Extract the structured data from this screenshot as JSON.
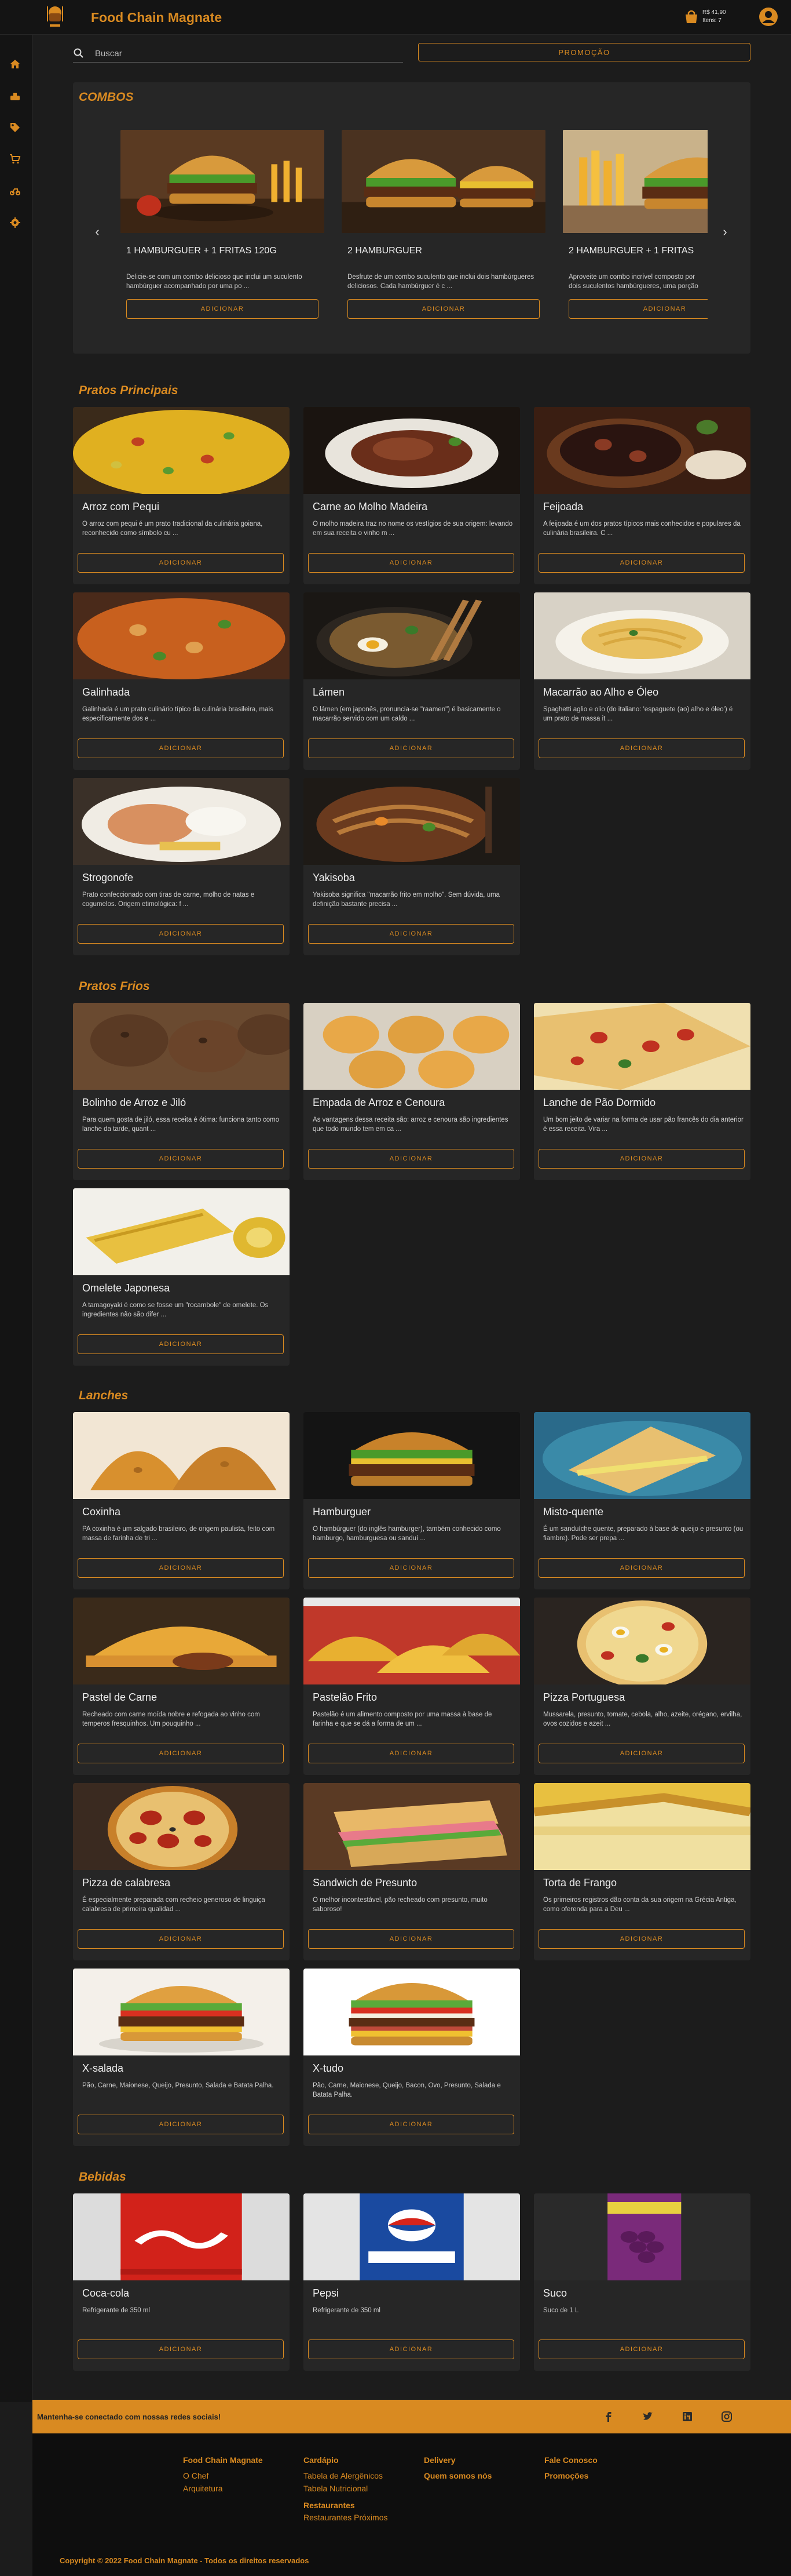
{
  "header": {
    "brand": "Food Chain Magnate",
    "cart_total": "R$ 41,90",
    "cart_items": "Itens: 7"
  },
  "search": {
    "placeholder": "Buscar",
    "value": ""
  },
  "promo_label": "PROMOÇÃO",
  "sidebar": {
    "items": [
      {
        "icon": "home-icon"
      },
      {
        "icon": "tools-icon"
      },
      {
        "icon": "tag-icon"
      },
      {
        "icon": "cart-icon"
      },
      {
        "icon": "delivery-icon"
      },
      {
        "icon": "settings-icon"
      }
    ]
  },
  "combos": {
    "title": "COMBOS",
    "items": [
      {
        "title": "1 HAMBURGUER + 1 FRITAS 120G",
        "desc": "Delicie-se com um combo delicioso que inclui um suculento hambúrguer acompanhado por uma po ...",
        "button": "ADICIONAR"
      },
      {
        "title": "2 HAMBURGUER",
        "desc": "Desfrute de um combo suculento que inclui dois hambúrgueres deliciosos. Cada hambúrguer é c ...",
        "button": "ADICIONAR"
      },
      {
        "title": "2 HAMBURGUER + 1 FRITAS",
        "desc": "Aproveite um combo incrível composto por dois suculentos hambúrgueres, uma porção",
        "button": "ADICIONAR"
      }
    ]
  },
  "sections": [
    {
      "title": "Pratos Principais",
      "items": [
        {
          "title": "Arroz com Pequi",
          "desc": "O arroz com pequi é um prato tradicional da culinária goiana, reconhecido como símbolo cu ...",
          "button": "ADICIONAR"
        },
        {
          "title": "Carne ao Molho Madeira",
          "desc": "O molho madeira traz no nome os vestígios de sua origem: levando em sua receita o vinho m ...",
          "button": "ADICIONAR"
        },
        {
          "title": "Feijoada",
          "desc": "A feijoada é um dos pratos típicos mais conhecidos e populares da culinária brasileira. C ...",
          "button": "ADICIONAR"
        },
        {
          "title": "Galinhada",
          "desc": "Galinhada é um prato culinário típico da culinária brasileira, mais especificamente dos e ...",
          "button": "ADICIONAR"
        },
        {
          "title": "Lámen",
          "desc": "O lámen (em japonês, pronuncia-se \"raamen\") é basicamente o macarrão servido com um caldo ...",
          "button": "ADICIONAR"
        },
        {
          "title": "Macarrão ao Alho e Óleo",
          "desc": "Spaghetti aglio e olio (do italiano: 'espaguete (ao) alho e óleo') é um prato de massa it ...",
          "button": "ADICIONAR"
        },
        {
          "title": "Strogonofe",
          "desc": "Prato confeccionado com tiras de carne, molho de natas e cogumelos. Origem etimológica: f ...",
          "button": "ADICIONAR"
        },
        {
          "title": "Yakisoba",
          "desc": "Yakisoba significa \"macarrão frito em molho\". Sem dúvida, uma definição bastante precisa ...",
          "button": "ADICIONAR"
        }
      ]
    },
    {
      "title": "Pratos Frios",
      "items": [
        {
          "title": "Bolinho de Arroz e Jiló",
          "desc": "Para quem gosta de jiló, essa receita é ótima: funciona tanto como lanche da tarde, quant ...",
          "button": "ADICIONAR"
        },
        {
          "title": "Empada de Arroz e Cenoura",
          "desc": "As vantagens dessa receita são: arroz e cenoura são ingredientes que todo mundo tem em ca ...",
          "button": "ADICIONAR"
        },
        {
          "title": "Lanche de Pão Dormido",
          "desc": "Um bom jeito de variar na forma de usar pão francês do dia anterior é essa receita. Vira ...",
          "button": "ADICIONAR"
        },
        {
          "title": "Omelete Japonesa",
          "desc": "A tamagoyaki é como se fosse um \"rocambole\" de omelete. Os ingredientes não são difer ...",
          "button": "ADICIONAR"
        }
      ]
    },
    {
      "title": "Lanches",
      "items": [
        {
          "title": "Coxinha",
          "desc": "PA coxinha é um salgado brasileiro, de origem paulista, feito com massa de farinha de tri ...",
          "button": "ADICIONAR"
        },
        {
          "title": "Hamburguer",
          "desc": "O hambúrguer (do inglês hamburger), também conhecido como hamburgo, hamburguesa ou sanduí ...",
          "button": "ADICIONAR"
        },
        {
          "title": "Misto-quente",
          "desc": "É um sanduíche quente, preparado à base de queijo e presunto (ou fiambre). Pode ser prepa ...",
          "button": "ADICIONAR"
        },
        {
          "title": "Pastel de Carne",
          "desc": "Recheado com carne moída nobre e refogada ao vinho com temperos fresquinhos. Um pouquinho ...",
          "button": "ADICIONAR"
        },
        {
          "title": "Pastelão Frito",
          "desc": "Pastelão é um alimento composto por uma massa à base de farinha e que se dá a forma de um ...",
          "button": "ADICIONAR"
        },
        {
          "title": "Pizza Portuguesa",
          "desc": "Mussarela, presunto, tomate, cebola, alho, azeite, orégano, ervilha, ovos cozidos e azeit ...",
          "button": "ADICIONAR"
        },
        {
          "title": "Pizza de calabresa",
          "desc": "É especialmente preparada com recheio generoso de linguiça calabresa de primeira qualidad ...",
          "button": "ADICIONAR"
        },
        {
          "title": "Sandwich de Presunto",
          "desc": "O melhor incontestável, pão recheado com presunto, muito saboroso!",
          "button": "ADICIONAR"
        },
        {
          "title": "Torta de Frango",
          "desc": "Os primeiros registros dão conta da sua origem na Grécia Antiga, como oferenda para a Deu ...",
          "button": "ADICIONAR"
        },
        {
          "title": "X-salada",
          "desc": "Pão, Carne, Maionese, Queijo, Presunto, Salada e Batata Palha.",
          "button": "ADICIONAR"
        },
        {
          "title": "X-tudo",
          "desc": "Pão, Carne, Maionese, Queijo, Bacon, Ovo, Presunto, Salada e Batata Palha.",
          "button": "ADICIONAR"
        }
      ]
    },
    {
      "title": "Bebidas",
      "items": [
        {
          "title": "Coca-cola",
          "desc": "Refrigerante de 350 ml",
          "button": "ADICIONAR"
        },
        {
          "title": "Pepsi",
          "desc": "Refrigerante de 350 ml",
          "button": "ADICIONAR"
        },
        {
          "title": "Suco",
          "desc": "Suco de 1 L",
          "button": "ADICIONAR"
        }
      ]
    }
  ],
  "social": {
    "text": "Mantenha-se conectado com nossas redes sociais!",
    "icons": [
      "facebook-icon",
      "twitter-icon",
      "linkedin-icon",
      "instagram-icon"
    ]
  },
  "footer": {
    "columns": [
      {
        "heading": "Food Chain Magnate",
        "items": [
          "O Chef",
          "Arquitetura"
        ]
      },
      {
        "heading": "Cardápio",
        "items": [
          "Tabela de Alergênicos",
          "Tabela Nutricional"
        ],
        "heading2": "Restaurantes",
        "items2": [
          "Restaurantes Próximos"
        ]
      },
      {
        "heading": "Delivery",
        "items": [
          "Quem somos nós"
        ]
      },
      {
        "heading": "Fale Conosco",
        "items": [
          "Promoções"
        ]
      }
    ],
    "copyright": "Copyright © 2022 Food Chain Magnate - Todos os direitos reservados"
  }
}
